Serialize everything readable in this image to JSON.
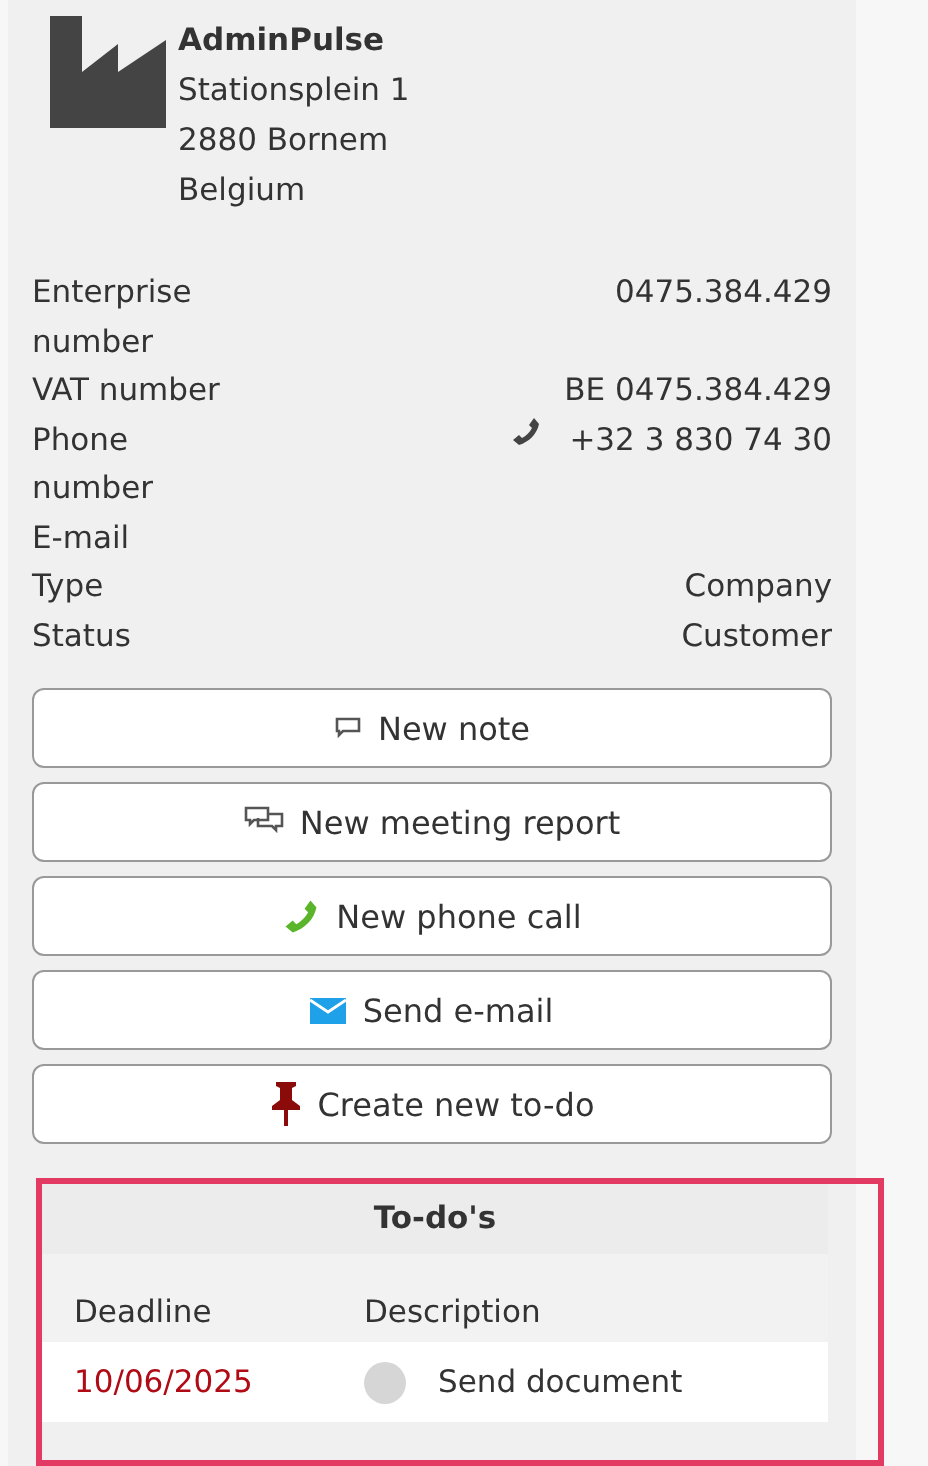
{
  "company": {
    "name": "AdminPulse",
    "address": [
      "Stationsplein 1",
      "2880 Bornem",
      "Belgium"
    ]
  },
  "details": [
    {
      "label": "Enterprise number",
      "value": "0475.384.429",
      "kind": "text"
    },
    {
      "label": "VAT number",
      "value": "BE 0475.384.429",
      "kind": "text"
    },
    {
      "label": "Phone number",
      "value": "+32 3 830 74 30",
      "kind": "phone"
    },
    {
      "label": "E-mail",
      "kind": "text"
    },
    {
      "label": "Type",
      "value": "Company",
      "kind": "text"
    },
    {
      "label": "Status",
      "value": "Customer",
      "kind": "text"
    }
  ],
  "actions": [
    {
      "label": "New note",
      "kind": "note"
    },
    {
      "label": "New meeting report",
      "kind": "meeting"
    },
    {
      "label": "New phone call",
      "kind": "call"
    },
    {
      "label": "Send e-mail",
      "kind": "mail"
    },
    {
      "label": "Create new to-do",
      "kind": "todo"
    }
  ],
  "todos": {
    "title": "To-do's",
    "columns": [
      "Deadline",
      "Description"
    ],
    "rows": [
      {
        "deadline": "10/06/2025",
        "description": "Send document",
        "completed": false
      }
    ]
  }
}
